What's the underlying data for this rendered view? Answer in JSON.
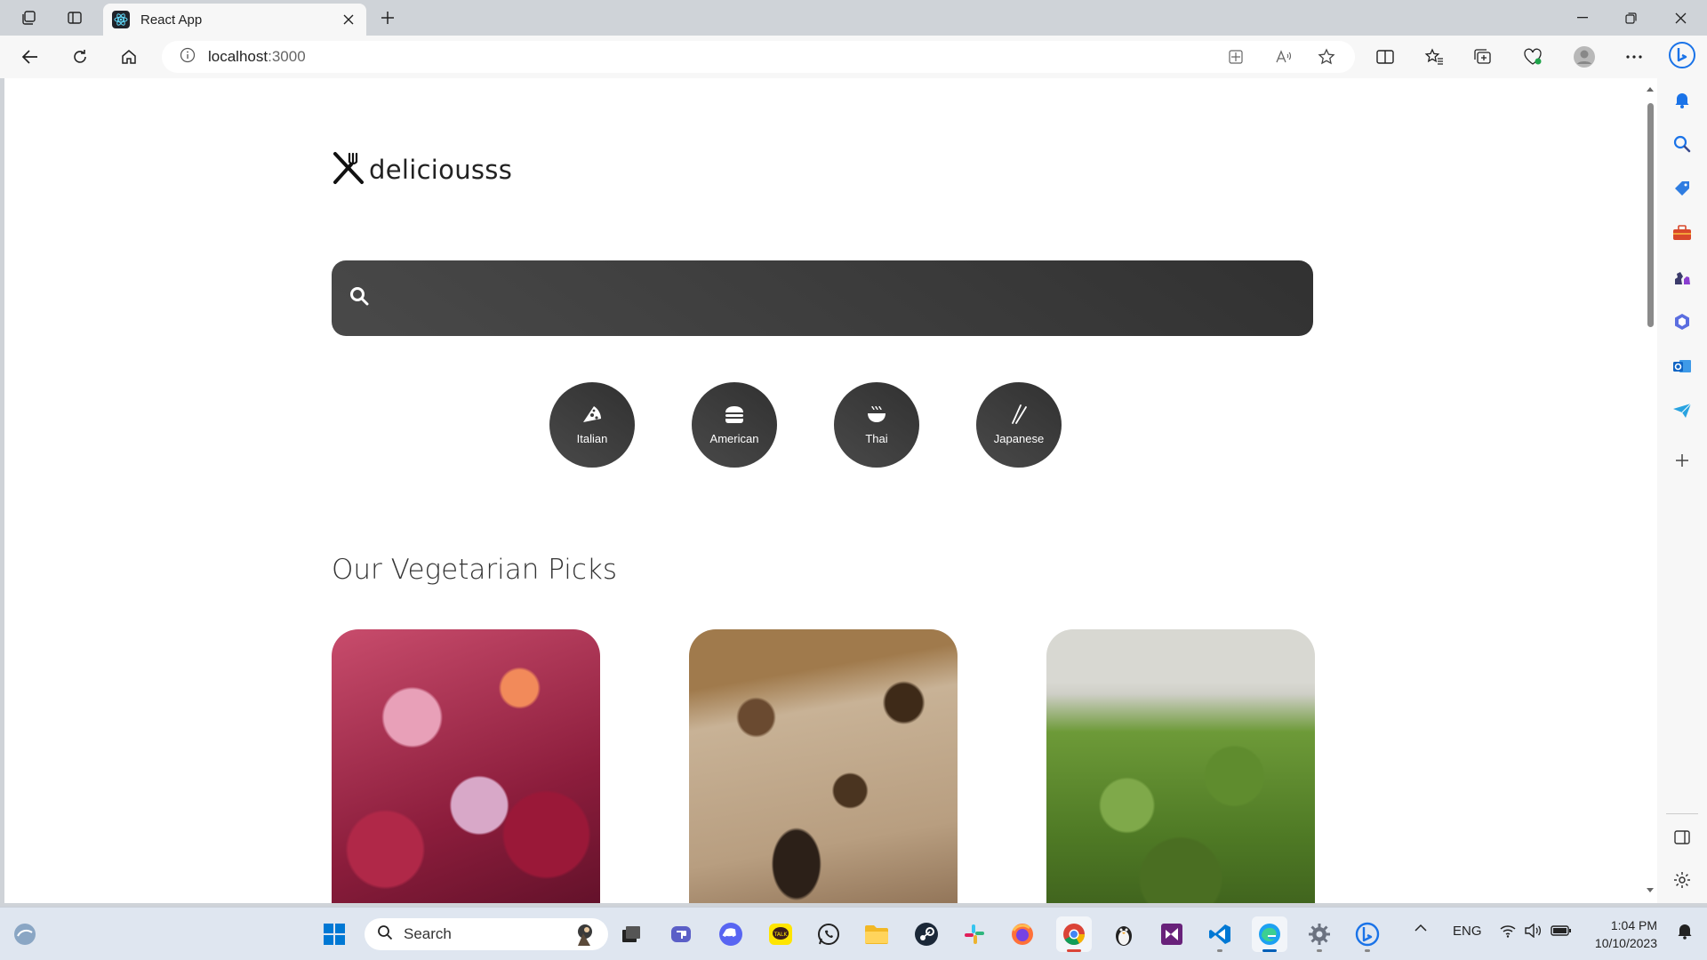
{
  "browser": {
    "tab_title": "React App",
    "url_host": "localhost",
    "url_port": ":3000"
  },
  "page": {
    "logo_text": "deliciousss",
    "search": {
      "value": "",
      "placeholder": ""
    },
    "cuisines": [
      {
        "label": "Italian",
        "icon": "pizza-icon"
      },
      {
        "label": "American",
        "icon": "burger-icon"
      },
      {
        "label": "Thai",
        "icon": "noodle-bowl-icon"
      },
      {
        "label": "Japanese",
        "icon": "chopsticks-icon"
      }
    ],
    "section_title": "Our Vegetarian Picks",
    "cards": [
      {
        "image": "red-vegetable-relish-photo"
      },
      {
        "image": "chocolate-chunk-bread-photo"
      },
      {
        "image": "green-pesto-photo"
      }
    ]
  },
  "taskbar": {
    "search_label": "Search",
    "language": "ENG",
    "time": "1:04 PM",
    "date": "10/10/2023"
  },
  "colors": {
    "card_dark": "#313131",
    "accent": "#005fb8"
  }
}
